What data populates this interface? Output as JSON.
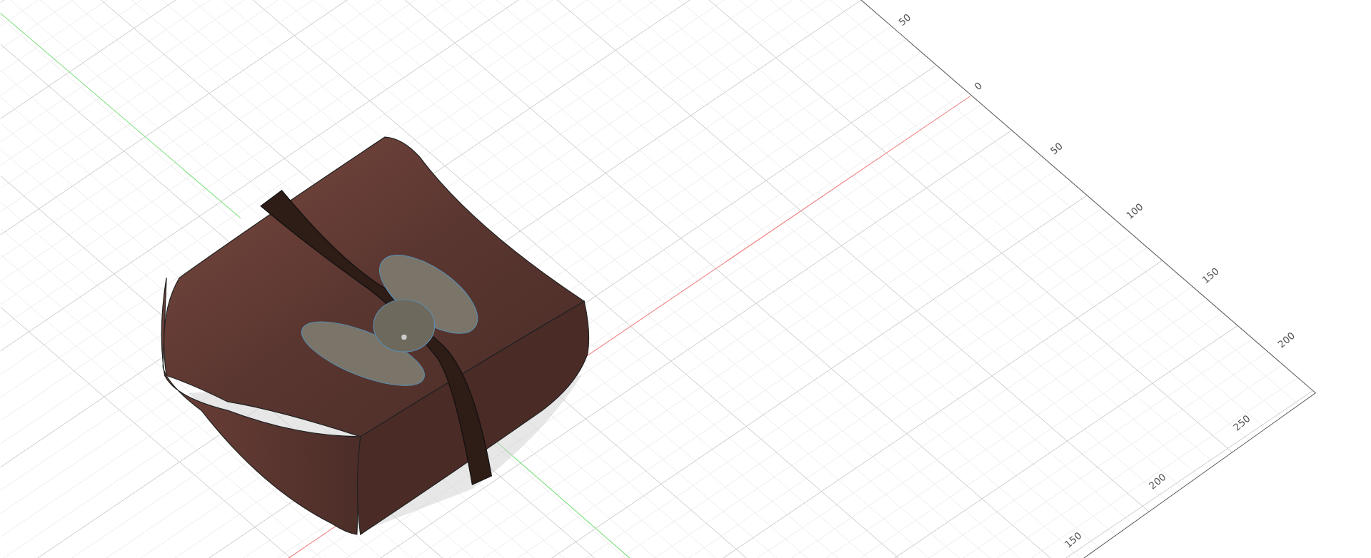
{
  "viewport": {
    "axis_a_labels": [
      "50",
      "0",
      "50",
      "100",
      "150",
      "200"
    ],
    "axis_b_labels": [
      "250",
      "200",
      "150"
    ]
  }
}
